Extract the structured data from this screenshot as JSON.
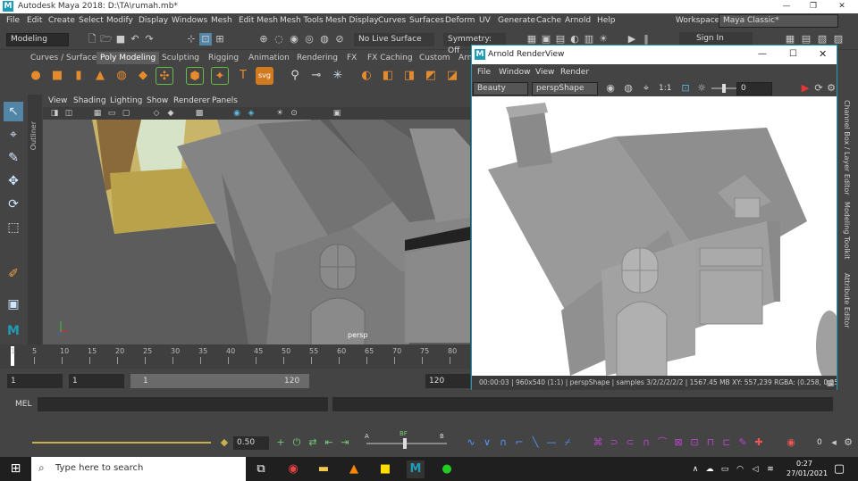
{
  "window": {
    "title": "Autodesk Maya 2018: D:\\TA\\rumah.mb*",
    "logo": "M"
  },
  "menus": [
    "File",
    "Edit",
    "Create",
    "Select",
    "Modify",
    "Display",
    "Windows",
    "Mesh",
    "Edit Mesh",
    "Mesh Tools",
    "Mesh Display",
    "Curves",
    "Surfaces",
    "Deform",
    "UV",
    "Generate",
    "Cache",
    "Arnold",
    "Help"
  ],
  "workspace": {
    "label": "Workspace :",
    "value": "Maya Classic*"
  },
  "status": {
    "mode": "Modeling",
    "live_surface": "No Live Surface",
    "symmetry": "Symmetry: Off",
    "sign_in": "Sign In"
  },
  "shelf_tabs": [
    "Curves / Surfaces",
    "Poly Modeling",
    "Sculpting",
    "Rigging",
    "Animation",
    "Rendering",
    "FX",
    "FX Caching",
    "Custom",
    "Arn"
  ],
  "shelf_active": "Poly Modeling",
  "outliner_label": "Outliner",
  "viewport": {
    "menus": [
      "View",
      "Shading",
      "Lighting",
      "Show",
      "Renderer",
      "Panels"
    ],
    "camera_label": "persp"
  },
  "timeline": {
    "ticks": [
      "1",
      "5",
      "10",
      "15",
      "20",
      "25",
      "30",
      "35",
      "40",
      "45",
      "50",
      "55",
      "60",
      "65",
      "70",
      "75",
      "80"
    ],
    "current": "1"
  },
  "range": {
    "start": "1",
    "start2": "1",
    "slider_start": "1",
    "slider_end": "120",
    "end": "120"
  },
  "mel": {
    "label": "MEL"
  },
  "bottom": {
    "value": "0.50",
    "a": "A",
    "b": "B",
    "bf": "BF",
    "zero": "0"
  },
  "arnold": {
    "title": "Arnold RenderView",
    "menus": [
      "File",
      "Window",
      "View",
      "Render"
    ],
    "aov": "Beauty",
    "camera": "perspShape",
    "ratio": "1:1",
    "exposure": "0",
    "status": "00:00:03 | 960x540 (1:1) | perspShape | samples 3/2/2/2/2/2 | 1567.45 MB XY: 557,239   RGBA: (0.258, 0.258, 0."
  },
  "channel_box": {
    "labels": [
      "Channel Box / Layer Editor",
      "Modeling Toolkit",
      "Attribute Editor"
    ]
  },
  "taskbar": {
    "search_placeholder": "Type here to search",
    "time": "0:27",
    "date": "27/01/2021"
  }
}
